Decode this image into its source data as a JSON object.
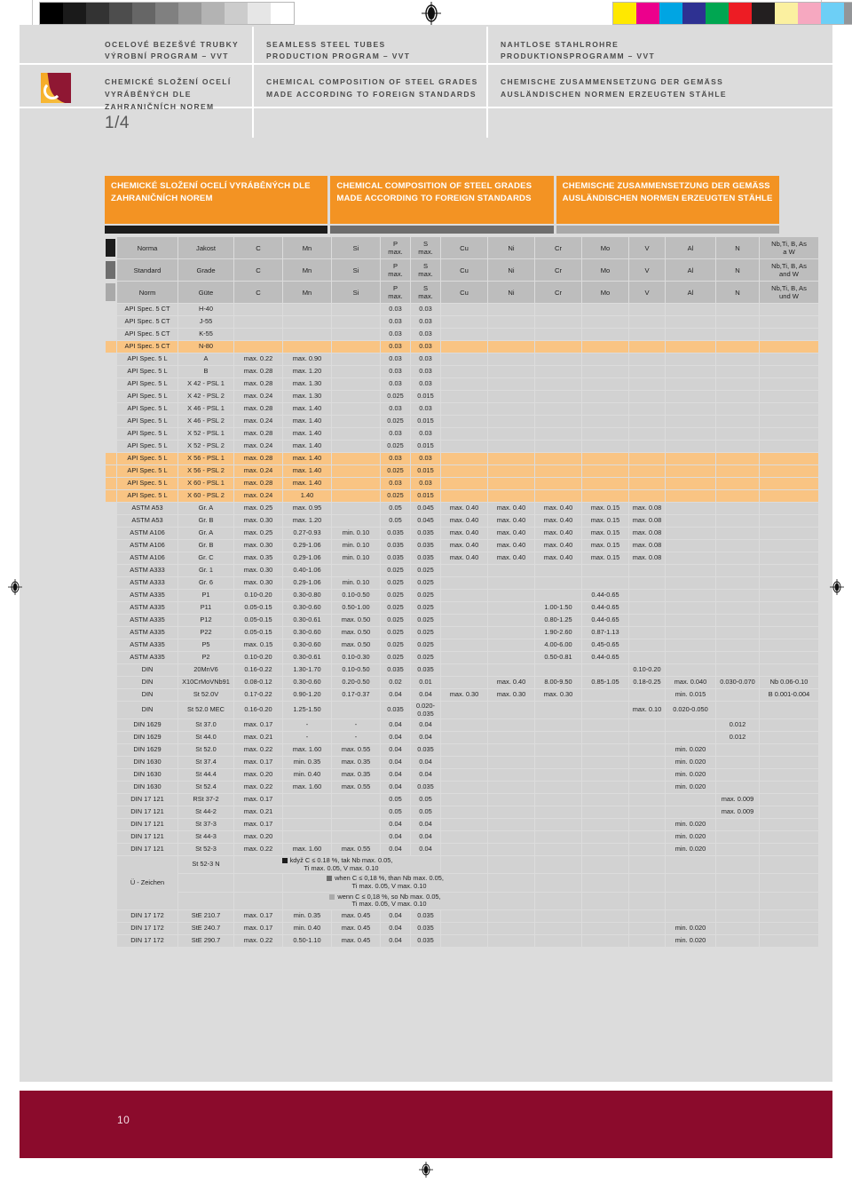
{
  "document": {
    "page_number_footer": "10",
    "section_index": "1/4"
  },
  "header": {
    "columns": [
      {
        "title_line1": "OCELOVÉ BEZEŠVÉ TRUBKY",
        "title_line2": "VÝROBNÍ PROGRAM – VVT",
        "subtitle_line1": "CHEMICKÉ SLOŽENÍ OCELÍ VYRÁBĚNÝCH DLE",
        "subtitle_line2": "ZAHRANIČNÍCH NOREM"
      },
      {
        "title_line1": "SEAMLESS STEEL TUBES",
        "title_line2": "PRODUCTION PROGRAM – VVT",
        "subtitle_line1": "CHEMICAL COMPOSITION OF STEEL GRADES",
        "subtitle_line2": "MADE ACCORDING TO FOREIGN STANDARDS"
      },
      {
        "title_line1": "NAHTLOSE STAHLROHRE",
        "title_line2": "PRODUKTIONSPROGRAMM – VVT",
        "subtitle_line1": "CHEMISCHE ZUSAMMENSETZUNG DER GEMÄSS",
        "subtitle_line2": "AUSLÄNDISCHEN NORMEN ERZEUGTEN STÄHLE"
      }
    ]
  },
  "banners": [
    "CHEMICKÉ SLOŽENÍ OCELÍ VYRÁBĚNÝCH DLE ZAHRANIČNÍCH NOREM",
    "CHEMICAL COMPOSITION OF STEEL GRADES MADE ACCORDING TO FOREIGN STANDARDS",
    "CHEMISCHE ZUSAMMENSETZUNG DER GEMÄSS AUSLÄNDISCHEN NORMEN ERZEUGTEN STÄHLE"
  ],
  "colors": {
    "accent_orange": "#f39323",
    "highlight_row": "#f9c483",
    "footer_burgundy": "#8b0b2c",
    "page_grey": "#dcdcdc",
    "cell_grey": "#d2d2d2",
    "header_grey": "#bdbdbd"
  },
  "calibration_swatches": {
    "left_greys": [
      "#000000",
      "#1a1a1a",
      "#333333",
      "#4d4d4d",
      "#666666",
      "#808080",
      "#999999",
      "#b3b3b3",
      "#cccccc",
      "#e6e6e6",
      "#ffffff"
    ],
    "right_colors": [
      "#ffe800",
      "#ec008c",
      "#00a5e3",
      "#2e3192",
      "#00a651",
      "#ed1c24",
      "#231f20",
      "#fbf0a0",
      "#f6a8c0",
      "#6dcff6",
      "#939598"
    ]
  },
  "table": {
    "header_rows": [
      {
        "lang": "cs",
        "tone": "sw-dark",
        "cells": [
          "Norma",
          "Jakost",
          "C",
          "Mn",
          "Si",
          "P\nmax.",
          "S\nmax.",
          "Cu",
          "Ni",
          "Cr",
          "Mo",
          "V",
          "Al",
          "N",
          "Nb,Ti, B, As\na W"
        ]
      },
      {
        "lang": "en",
        "tone": "sw-mid",
        "cells": [
          "Standard",
          "Grade",
          "C",
          "Mn",
          "Si",
          "P\nmax.",
          "S\nmax.",
          "Cu",
          "Ni",
          "Cr",
          "Mo",
          "V",
          "Al",
          "N",
          "Nb,Ti, B, As\nand W"
        ]
      },
      {
        "lang": "de",
        "tone": "sw-light",
        "cells": [
          "Norm",
          "Güte",
          "C",
          "Mn",
          "Si",
          "P\nmax.",
          "S\nmax.",
          "Cu",
          "Ni",
          "Cr",
          "Mo",
          "V",
          "Al",
          "N",
          "Nb,Ti, B, As\nund W"
        ]
      }
    ],
    "rows": [
      {
        "highlight": false,
        "cells": [
          "API Spec. 5 CT",
          "H-40",
          "",
          "",
          "",
          "0.03",
          "0.03",
          "",
          "",
          "",
          "",
          "",
          "",
          "",
          ""
        ]
      },
      {
        "highlight": false,
        "cells": [
          "API Spec. 5 CT",
          "J-55",
          "",
          "",
          "",
          "0.03",
          "0.03",
          "",
          "",
          "",
          "",
          "",
          "",
          "",
          ""
        ]
      },
      {
        "highlight": false,
        "cells": [
          "API Spec. 5 CT",
          "K-55",
          "",
          "",
          "",
          "0.03",
          "0.03",
          "",
          "",
          "",
          "",
          "",
          "",
          "",
          ""
        ]
      },
      {
        "highlight": true,
        "cells": [
          "API Spec. 5 CT",
          "N-80",
          "",
          "",
          "",
          "0.03",
          "0.03",
          "",
          "",
          "",
          "",
          "",
          "",
          "",
          ""
        ]
      },
      {
        "highlight": false,
        "cells": [
          "API Spec. 5 L",
          "A",
          "max. 0.22",
          "max. 0.90",
          "",
          "0.03",
          "0.03",
          "",
          "",
          "",
          "",
          "",
          "",
          "",
          ""
        ]
      },
      {
        "highlight": false,
        "cells": [
          "API Spec. 5 L",
          "B",
          "max. 0.28",
          "max. 1.20",
          "",
          "0.03",
          "0.03",
          "",
          "",
          "",
          "",
          "",
          "",
          "",
          ""
        ]
      },
      {
        "highlight": false,
        "cells": [
          "API Spec. 5 L",
          "X 42 - PSL 1",
          "max. 0.28",
          "max. 1.30",
          "",
          "0.03",
          "0.03",
          "",
          "",
          "",
          "",
          "",
          "",
          "",
          ""
        ]
      },
      {
        "highlight": false,
        "cells": [
          "API Spec. 5 L",
          "X 42 - PSL 2",
          "max. 0.24",
          "max. 1.30",
          "",
          "0.025",
          "0.015",
          "",
          "",
          "",
          "",
          "",
          "",
          "",
          ""
        ]
      },
      {
        "highlight": false,
        "cells": [
          "API Spec. 5 L",
          "X 46 - PSL 1",
          "max. 0.28",
          "max. 1.40",
          "",
          "0.03",
          "0.03",
          "",
          "",
          "",
          "",
          "",
          "",
          "",
          ""
        ]
      },
      {
        "highlight": false,
        "cells": [
          "API Spec. 5 L",
          "X 46 - PSL 2",
          "max. 0.24",
          "max. 1.40",
          "",
          "0.025",
          "0.015",
          "",
          "",
          "",
          "",
          "",
          "",
          "",
          ""
        ]
      },
      {
        "highlight": false,
        "cells": [
          "API Spec. 5 L",
          "X 52 - PSL 1",
          "max. 0.28",
          "max. 1.40",
          "",
          "0.03",
          "0.03",
          "",
          "",
          "",
          "",
          "",
          "",
          "",
          ""
        ]
      },
      {
        "highlight": false,
        "cells": [
          "API Spec. 5 L",
          "X 52 - PSL 2",
          "max. 0.24",
          "max. 1.40",
          "",
          "0.025",
          "0.015",
          "",
          "",
          "",
          "",
          "",
          "",
          "",
          ""
        ]
      },
      {
        "highlight": true,
        "cells": [
          "API Spec. 5 L",
          "X 56 - PSL 1",
          "max. 0.28",
          "max. 1.40",
          "",
          "0.03",
          "0.03",
          "",
          "",
          "",
          "",
          "",
          "",
          "",
          ""
        ]
      },
      {
        "highlight": true,
        "cells": [
          "API Spec. 5 L",
          "X 56 - PSL 2",
          "max. 0.24",
          "max. 1.40",
          "",
          "0.025",
          "0.015",
          "",
          "",
          "",
          "",
          "",
          "",
          "",
          ""
        ]
      },
      {
        "highlight": true,
        "cells": [
          "API Spec. 5 L",
          "X 60 - PSL 1",
          "max. 0.28",
          "max. 1.40",
          "",
          "0.03",
          "0.03",
          "",
          "",
          "",
          "",
          "",
          "",
          "",
          ""
        ]
      },
      {
        "highlight": true,
        "cells": [
          "API Spec. 5 L",
          "X 60 - PSL 2",
          "max. 0.24",
          "1.40",
          "",
          "0.025",
          "0.015",
          "",
          "",
          "",
          "",
          "",
          "",
          "",
          ""
        ]
      },
      {
        "highlight": false,
        "cells": [
          "ASTM A53",
          "Gr. A",
          "max. 0.25",
          "max. 0.95",
          "",
          "0.05",
          "0.045",
          "max. 0.40",
          "max. 0.40",
          "max. 0.40",
          "max. 0.15",
          "max. 0.08",
          "",
          "",
          ""
        ]
      },
      {
        "highlight": false,
        "cells": [
          "ASTM A53",
          "Gr. B",
          "max. 0.30",
          "max. 1.20",
          "",
          "0.05",
          "0.045",
          "max. 0.40",
          "max. 0.40",
          "max. 0.40",
          "max. 0.15",
          "max. 0.08",
          "",
          "",
          ""
        ]
      },
      {
        "highlight": false,
        "cells": [
          "ASTM A106",
          "Gr. A",
          "max. 0.25",
          "0.27-0.93",
          "min. 0.10",
          "0.035",
          "0.035",
          "max. 0.40",
          "max. 0.40",
          "max. 0.40",
          "max. 0.15",
          "max. 0.08",
          "",
          "",
          ""
        ]
      },
      {
        "highlight": false,
        "cells": [
          "ASTM A106",
          "Gr. B",
          "max. 0.30",
          "0.29-1.06",
          "min. 0.10",
          "0.035",
          "0.035",
          "max. 0.40",
          "max. 0.40",
          "max. 0.40",
          "max. 0.15",
          "max. 0.08",
          "",
          "",
          ""
        ]
      },
      {
        "highlight": false,
        "cells": [
          "ASTM A106",
          "Gr. C",
          "max. 0.35",
          "0.29-1.06",
          "min. 0.10",
          "0.035",
          "0.035",
          "max. 0.40",
          "max. 0.40",
          "max. 0.40",
          "max. 0.15",
          "max. 0.08",
          "",
          "",
          ""
        ]
      },
      {
        "highlight": false,
        "cells": [
          "ASTM A333",
          "Gr. 1",
          "max. 0.30",
          "0.40-1.06",
          "",
          "0.025",
          "0.025",
          "",
          "",
          "",
          "",
          "",
          "",
          "",
          ""
        ]
      },
      {
        "highlight": false,
        "cells": [
          "ASTM A333",
          "Gr. 6",
          "max. 0.30",
          "0.29-1.06",
          "min. 0.10",
          "0.025",
          "0.025",
          "",
          "",
          "",
          "",
          "",
          "",
          "",
          ""
        ]
      },
      {
        "highlight": false,
        "cells": [
          "ASTM A335",
          "P1",
          "0.10-0.20",
          "0.30-0.80",
          "0.10-0.50",
          "0.025",
          "0.025",
          "",
          "",
          "",
          "0.44-0.65",
          "",
          "",
          "",
          ""
        ]
      },
      {
        "highlight": false,
        "cells": [
          "ASTM A335",
          "P11",
          "0.05-0.15",
          "0.30-0.60",
          "0.50-1.00",
          "0.025",
          "0.025",
          "",
          "",
          "1.00-1.50",
          "0.44-0.65",
          "",
          "",
          "",
          ""
        ]
      },
      {
        "highlight": false,
        "cells": [
          "ASTM A335",
          "P12",
          "0.05-0.15",
          "0.30-0.61",
          "max. 0.50",
          "0.025",
          "0.025",
          "",
          "",
          "0.80-1.25",
          "0.44-0.65",
          "",
          "",
          "",
          ""
        ]
      },
      {
        "highlight": false,
        "cells": [
          "ASTM A335",
          "P22",
          "0.05-0.15",
          "0.30-0.60",
          "max. 0.50",
          "0.025",
          "0.025",
          "",
          "",
          "1.90-2.60",
          "0.87-1.13",
          "",
          "",
          "",
          ""
        ]
      },
      {
        "highlight": false,
        "cells": [
          "ASTM A335",
          "P5",
          "max. 0.15",
          "0.30-0.60",
          "max. 0.50",
          "0.025",
          "0.025",
          "",
          "",
          "4.00-6.00",
          "0.45-0.65",
          "",
          "",
          "",
          ""
        ]
      },
      {
        "highlight": false,
        "cells": [
          "ASTM A335",
          "P2",
          "0.10-0.20",
          "0.30-0.61",
          "0.10-0.30",
          "0.025",
          "0.025",
          "",
          "",
          "0.50-0.81",
          "0.44-0.65",
          "",
          "",
          "",
          ""
        ]
      },
      {
        "highlight": false,
        "cells": [
          "DIN",
          "20MnV6",
          "0.16-0.22",
          "1.30-1.70",
          "0.10-0.50",
          "0.035",
          "0.035",
          "",
          "",
          "",
          "",
          "0.10-0.20",
          "",
          "",
          ""
        ]
      },
      {
        "highlight": false,
        "cells": [
          "DIN",
          "X10CrMoVNb91",
          "0.08-0.12",
          "0.30-0.60",
          "0.20-0.50",
          "0.02",
          "0.01",
          "",
          "max. 0.40",
          "8.00-9.50",
          "0.85-1.05",
          "0.18-0.25",
          "max. 0.040",
          "0.030-0.070",
          "Nb 0.06-0.10"
        ]
      },
      {
        "highlight": false,
        "cells": [
          "DIN",
          "St 52.0V",
          "0.17-0.22",
          "0.90-1.20",
          "0.17-0.37",
          "0.04",
          "0.04",
          "max. 0.30",
          "max. 0.30",
          "max. 0.30",
          "",
          "",
          "min. 0.015",
          "",
          "B 0.001-0.004"
        ]
      },
      {
        "highlight": false,
        "cells": [
          "DIN",
          "St 52.0 MEC",
          "0.16-0.20",
          "1.25-1.50",
          "",
          "0.035",
          "0.020-\n0.035",
          "",
          "",
          "",
          "",
          "max. 0.10",
          "0.020-0.050",
          "",
          ""
        ]
      },
      {
        "highlight": false,
        "cells": [
          "DIN 1629",
          "St 37.0",
          "max. 0.17",
          "-",
          "-",
          "0.04",
          "0.04",
          "",
          "",
          "",
          "",
          "",
          "",
          "0.012",
          ""
        ]
      },
      {
        "highlight": false,
        "cells": [
          "DIN 1629",
          "St 44.0",
          "max. 0.21",
          "-",
          "-",
          "0.04",
          "0.04",
          "",
          "",
          "",
          "",
          "",
          "",
          "0.012",
          ""
        ]
      },
      {
        "highlight": false,
        "cells": [
          "DIN 1629",
          "St 52.0",
          "max. 0.22",
          "max. 1.60",
          "max. 0.55",
          "0.04",
          "0.035",
          "",
          "",
          "",
          "",
          "",
          "min. 0.020",
          "",
          ""
        ]
      },
      {
        "highlight": false,
        "cells": [
          "DIN 1630",
          "St 37.4",
          "max. 0.17",
          "min. 0.35",
          "max. 0.35",
          "0.04",
          "0.04",
          "",
          "",
          "",
          "",
          "",
          "min. 0.020",
          "",
          ""
        ]
      },
      {
        "highlight": false,
        "cells": [
          "DIN 1630",
          "St 44.4",
          "max. 0.20",
          "min. 0.40",
          "max. 0.35",
          "0.04",
          "0.04",
          "",
          "",
          "",
          "",
          "",
          "min. 0.020",
          "",
          ""
        ]
      },
      {
        "highlight": false,
        "cells": [
          "DIN 1630",
          "St 52.4",
          "max. 0.22",
          "max. 1.60",
          "max. 0.55",
          "0.04",
          "0.035",
          "",
          "",
          "",
          "",
          "",
          "min. 0.020",
          "",
          ""
        ]
      },
      {
        "highlight": false,
        "cells": [
          "DIN 17 121",
          "RSt 37-2",
          "max. 0.17",
          "",
          "",
          "0.05",
          "0.05",
          "",
          "",
          "",
          "",
          "",
          "",
          "max. 0.009",
          ""
        ]
      },
      {
        "highlight": false,
        "cells": [
          "DIN 17 121",
          "St 44-2",
          "max. 0.21",
          "",
          "",
          "0.05",
          "0.05",
          "",
          "",
          "",
          "",
          "",
          "",
          "max. 0.009",
          ""
        ]
      },
      {
        "highlight": false,
        "cells": [
          "DIN 17 121",
          "St 37-3",
          "max. 0.17",
          "",
          "",
          "0.04",
          "0.04",
          "",
          "",
          "",
          "",
          "",
          "min. 0.020",
          "",
          ""
        ]
      },
      {
        "highlight": false,
        "cells": [
          "DIN 17 121",
          "St 44-3",
          "max. 0.20",
          "",
          "",
          "0.04",
          "0.04",
          "",
          "",
          "",
          "",
          "",
          "min. 0.020",
          "",
          ""
        ]
      },
      {
        "highlight": false,
        "cells": [
          "DIN 17 121",
          "St 52-3",
          "max. 0.22",
          "max. 1.60",
          "max. 0.55",
          "0.04",
          "0.04",
          "",
          "",
          "",
          "",
          "",
          "min. 0.020",
          "",
          ""
        ]
      }
    ],
    "uzeichen": {
      "standard": "Ü - Zeichen",
      "grade": "St 52-3 N",
      "notes": [
        {
          "marker": "sq-dark",
          "line1": "když C ≤ 0.18 %, tak Nb max. 0.05,",
          "line2": "Ti max. 0.05, V max. 0.10"
        },
        {
          "marker": "sq-mid",
          "line1": "when C ≤ 0,18 %, than Nb max. 0.05,",
          "line2": "Ti max. 0.05, V max. 0.10"
        },
        {
          "marker": "sq-light",
          "line1": "wenn C ≤ 0,18 %, so Nb max. 0.05,",
          "line2": "Ti max. 0.05, V max. 0.10"
        }
      ]
    },
    "rows_tail": [
      {
        "highlight": false,
        "cells": [
          "DIN 17 172",
          "StE 210.7",
          "max. 0.17",
          "min. 0.35",
          "max. 0.45",
          "0.04",
          "0.035",
          "",
          "",
          "",
          "",
          "",
          "",
          "",
          ""
        ]
      },
      {
        "highlight": false,
        "cells": [
          "DIN 17 172",
          "StE 240.7",
          "max. 0.17",
          "min. 0.40",
          "max. 0.45",
          "0.04",
          "0.035",
          "",
          "",
          "",
          "",
          "",
          "min. 0.020",
          "",
          ""
        ]
      },
      {
        "highlight": false,
        "cells": [
          "DIN 17 172",
          "StE 290.7",
          "max. 0.22",
          "0.50-1.10",
          "max. 0.45",
          "0.04",
          "0.035",
          "",
          "",
          "",
          "",
          "",
          "min. 0.020",
          "",
          ""
        ]
      }
    ]
  }
}
